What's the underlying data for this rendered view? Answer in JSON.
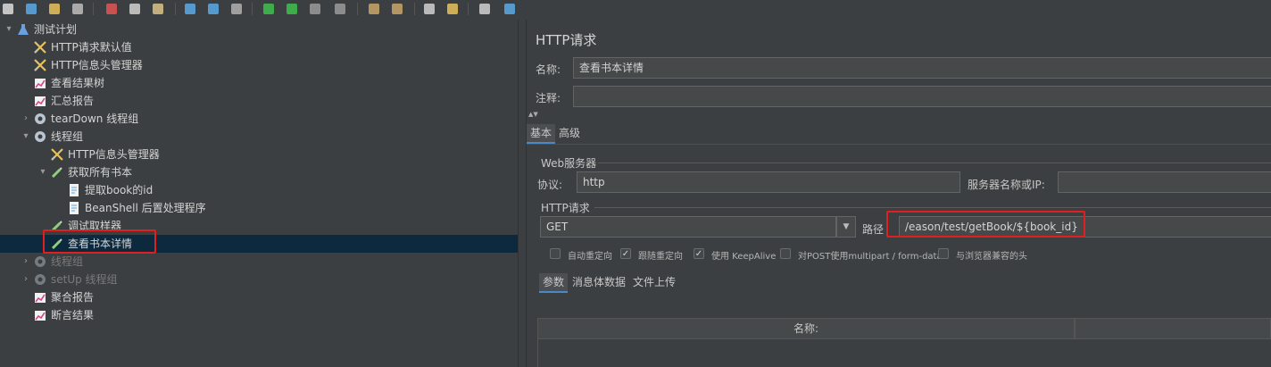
{
  "toolbar": {
    "buttons": [
      "new-icon",
      "templates-icon",
      "open-icon",
      "save-icon",
      "cut-icon",
      "copy-icon",
      "paste-icon",
      "expand-icon",
      "collapse-icon",
      "toggle-icon",
      "start-icon",
      "start-no-pause-icon",
      "stop-icon",
      "shutdown-icon",
      "clear-icon",
      "clear-all-icon",
      "search-icon",
      "reset-search-icon",
      "function-helper-icon",
      "help-icon"
    ]
  },
  "tree": [
    {
      "label": "测试计划",
      "icon": "flask-icon",
      "arrow": "▾",
      "indent": 0,
      "dim": false
    },
    {
      "label": "HTTP请求默认值",
      "icon": "wrench-icon",
      "arrow": "",
      "indent": 1,
      "dim": false
    },
    {
      "label": "HTTP信息头管理器",
      "icon": "wrench-icon",
      "arrow": "",
      "indent": 1,
      "dim": false
    },
    {
      "label": "查看结果树",
      "icon": "chart-icon",
      "arrow": "",
      "indent": 1,
      "dim": false
    },
    {
      "label": "汇总报告",
      "icon": "chart-icon",
      "arrow": "",
      "indent": 1,
      "dim": false
    },
    {
      "label": "tearDown 线程组",
      "icon": "gear-icon",
      "arrow": "›",
      "indent": 1,
      "dim": false
    },
    {
      "label": "线程组",
      "icon": "gear-icon",
      "arrow": "▾",
      "indent": 1,
      "dim": false
    },
    {
      "label": "HTTP信息头管理器",
      "icon": "wrench-icon",
      "arrow": "",
      "indent": 2,
      "dim": false
    },
    {
      "label": "获取所有书本",
      "icon": "pipette-icon",
      "arrow": "▾",
      "indent": 2,
      "dim": false
    },
    {
      "label": "提取book的id",
      "icon": "document-icon",
      "arrow": "",
      "indent": 3,
      "dim": false
    },
    {
      "label": "BeanShell 后置处理程序",
      "icon": "document-icon",
      "arrow": "",
      "indent": 3,
      "dim": false
    },
    {
      "label": "调试取样器",
      "icon": "pipette-icon",
      "arrow": "",
      "indent": 2,
      "dim": false
    },
    {
      "label": "查看书本详情",
      "icon": "pipette-icon",
      "arrow": "",
      "indent": 2,
      "dim": false,
      "selected": true
    },
    {
      "label": "线程组",
      "icon": "gear-icon",
      "arrow": "›",
      "indent": 1,
      "dim": true
    },
    {
      "label": "setUp 线程组",
      "icon": "gear-icon",
      "arrow": "›",
      "indent": 1,
      "dim": true
    },
    {
      "label": "聚合报告",
      "icon": "chart-icon",
      "arrow": "",
      "indent": 1,
      "dim": false
    },
    {
      "label": "断言结果",
      "icon": "chart-icon",
      "arrow": "",
      "indent": 1,
      "dim": false
    }
  ],
  "panel": {
    "title": "HTTP请求",
    "name_label": "名称:",
    "name_value": "查看书本详情",
    "comment_label": "注释:",
    "comment_value": "",
    "splitter_arrows": "▲▼",
    "tabs": [
      {
        "label": "基本",
        "active": true
      },
      {
        "label": "高级",
        "active": false
      }
    ],
    "web_server": {
      "group_label": "Web服务器",
      "protocol_label": "协议:",
      "protocol_value": "http",
      "server_label": "服务器名称或IP:",
      "server_value": ""
    },
    "http_request": {
      "group_label": "HTTP请求",
      "method_value": "GET",
      "path_label": "路径",
      "path_value": "/eason/test/getBook/${book_id}"
    },
    "checkboxes": [
      {
        "label": "自动重定向",
        "checked": false
      },
      {
        "label": "跟随重定向",
        "checked": true
      },
      {
        "label": "使用 KeepAlive",
        "checked": true
      },
      {
        "label": "对POST使用multipart / form-data",
        "checked": false
      },
      {
        "label": "与浏览器兼容的头",
        "checked": false
      }
    ],
    "sub_tabs": [
      {
        "label": "参数",
        "active": true
      },
      {
        "label": "消息体数据",
        "active": false
      },
      {
        "label": "文件上传",
        "active": false
      }
    ],
    "table": {
      "col_name": "名称:"
    }
  },
  "colors": {
    "highlight": "#e02020",
    "selected_row": "#0d293e",
    "tab_accent": "#4a88c7"
  }
}
